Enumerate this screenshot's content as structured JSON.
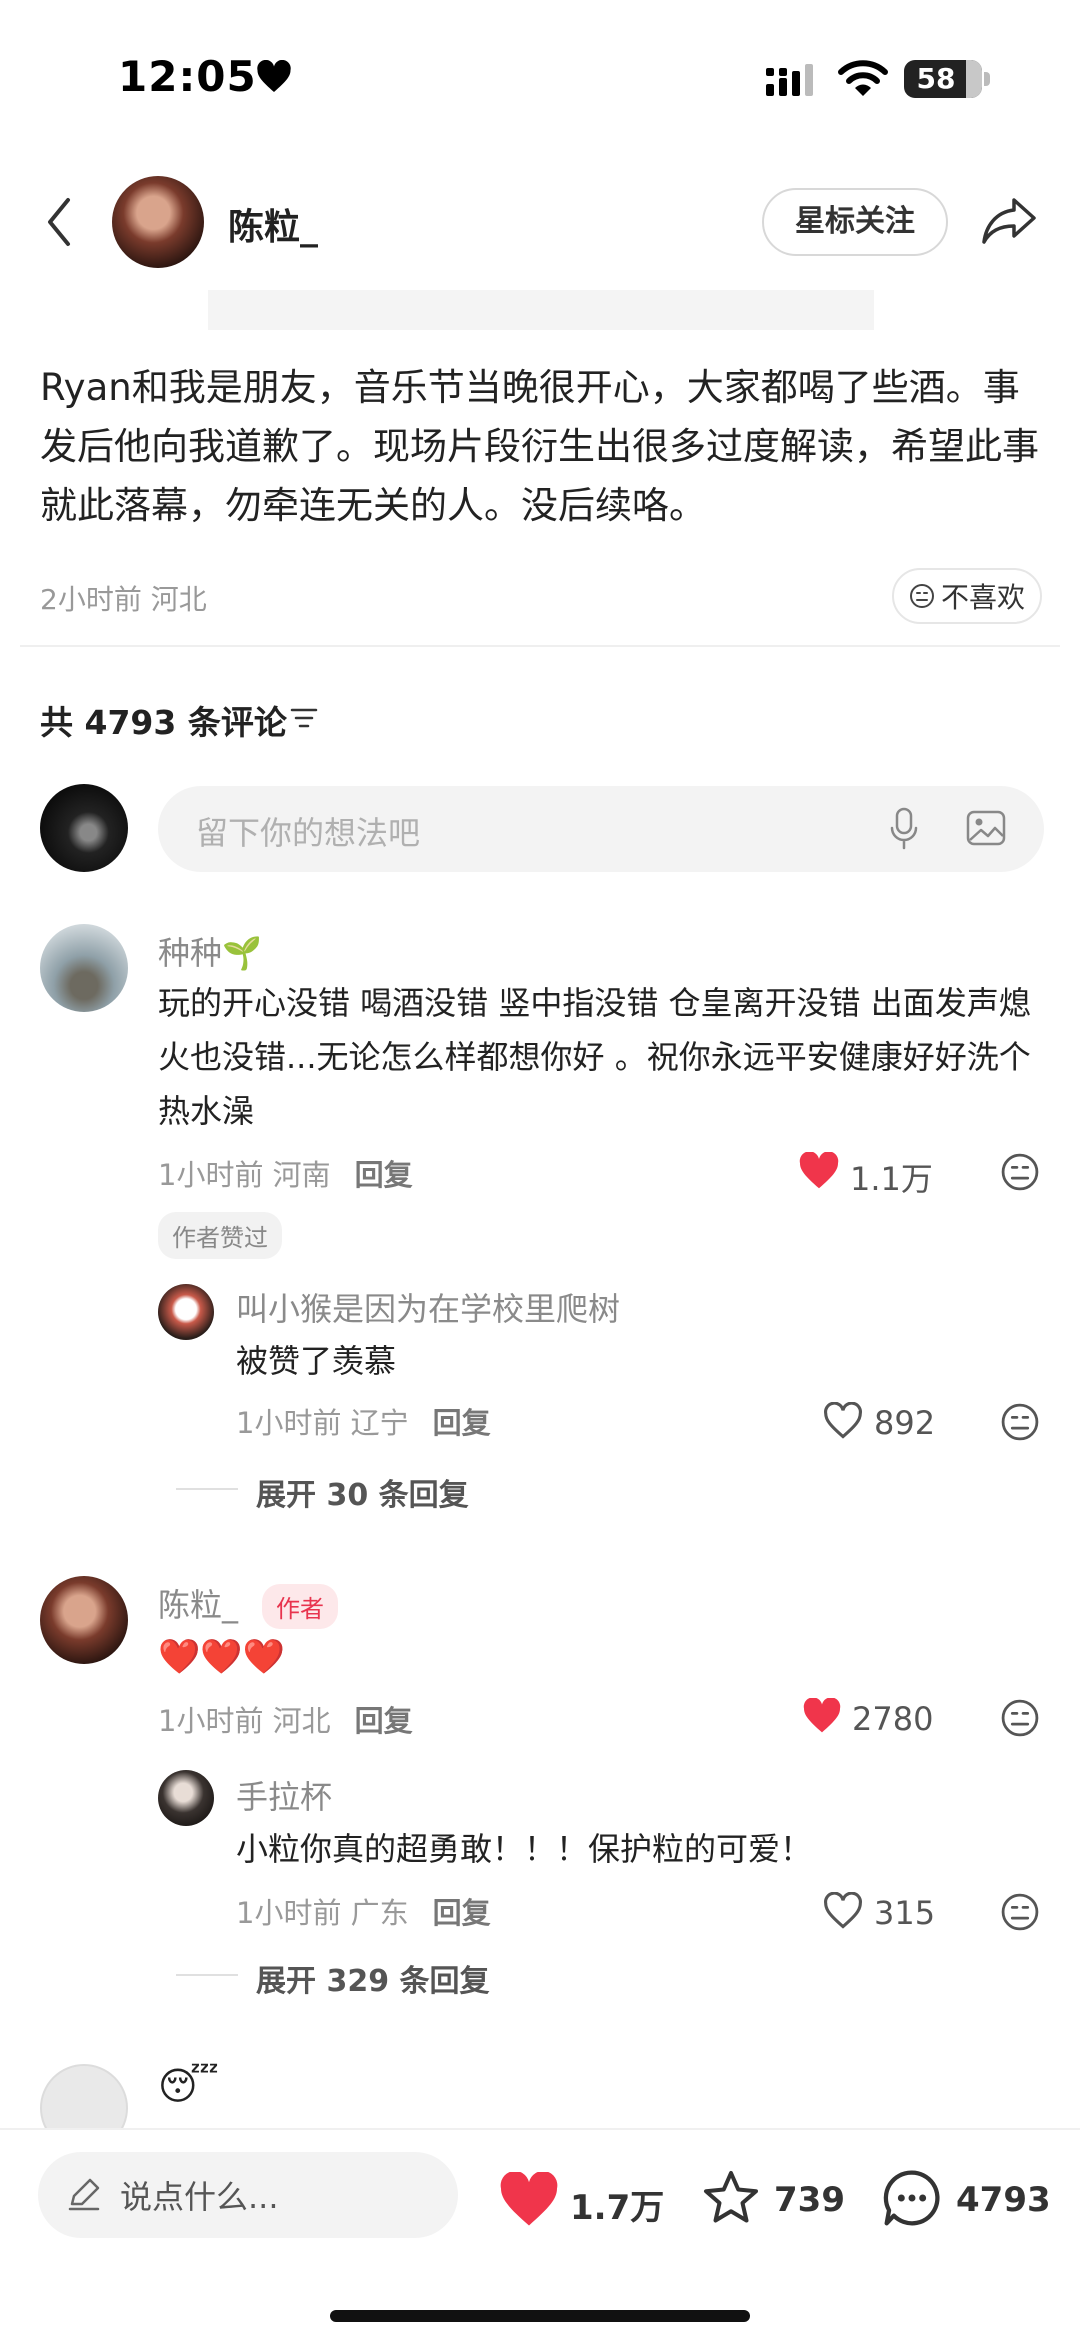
{
  "status_bar": {
    "time": "12:05",
    "battery": "58"
  },
  "header": {
    "author_name": "陈粒_",
    "follow_label": "星标关注"
  },
  "post": {
    "text": "Ryan和我是朋友，音乐节当晚很开心，大家都喝了些酒。事发后他向我道歉了。现场片段衍生出很多过度解读，希望此事就此落幕，勿牵连无关的人。没后续咯。",
    "meta": "2小时前 河北",
    "dislike_label": "不喜欢"
  },
  "comments_section": {
    "count_title": "共 4793 条评论",
    "input_placeholder": "留下你的想法吧"
  },
  "comments": [
    {
      "name": "种种🌱",
      "text": "玩的开心没错 喝酒没错 竖中指没错 仓皇离开没错 出面发声熄火也没错...无论怎么样都想你好 。祝你永远平安健康好好洗个热水澡",
      "meta": "1小时前 河南",
      "reply_label": "回复",
      "likes": "1.1万",
      "tag": "作者赞过",
      "reply": {
        "name": "叫小猴是因为在学校里爬树",
        "text": "被赞了羡慕",
        "meta": "1小时前 辽宁",
        "reply_label": "回复",
        "likes": "892"
      },
      "expand": "展开 30 条回复"
    },
    {
      "name": "陈粒_",
      "author_tag": "作者",
      "text": "❤️❤️❤️",
      "meta": "1小时前 河北",
      "reply_label": "回复",
      "likes": "2780",
      "reply": {
        "name": "手拉杯",
        "text": "小粒你真的超勇敢！！！保护粒的可爱！",
        "meta": "1小时前 广东",
        "reply_label": "回复",
        "likes": "315"
      },
      "expand": "展开 329 条回复"
    },
    {
      "text": "😴"
    }
  ],
  "bottom_bar": {
    "say_placeholder": "说点什么...",
    "likes": "1.7万",
    "stars": "739",
    "comments": "4793"
  },
  "colors": {
    "like_red": "#f0354b",
    "text_dark": "#222222",
    "meta_grey": "#999999"
  }
}
